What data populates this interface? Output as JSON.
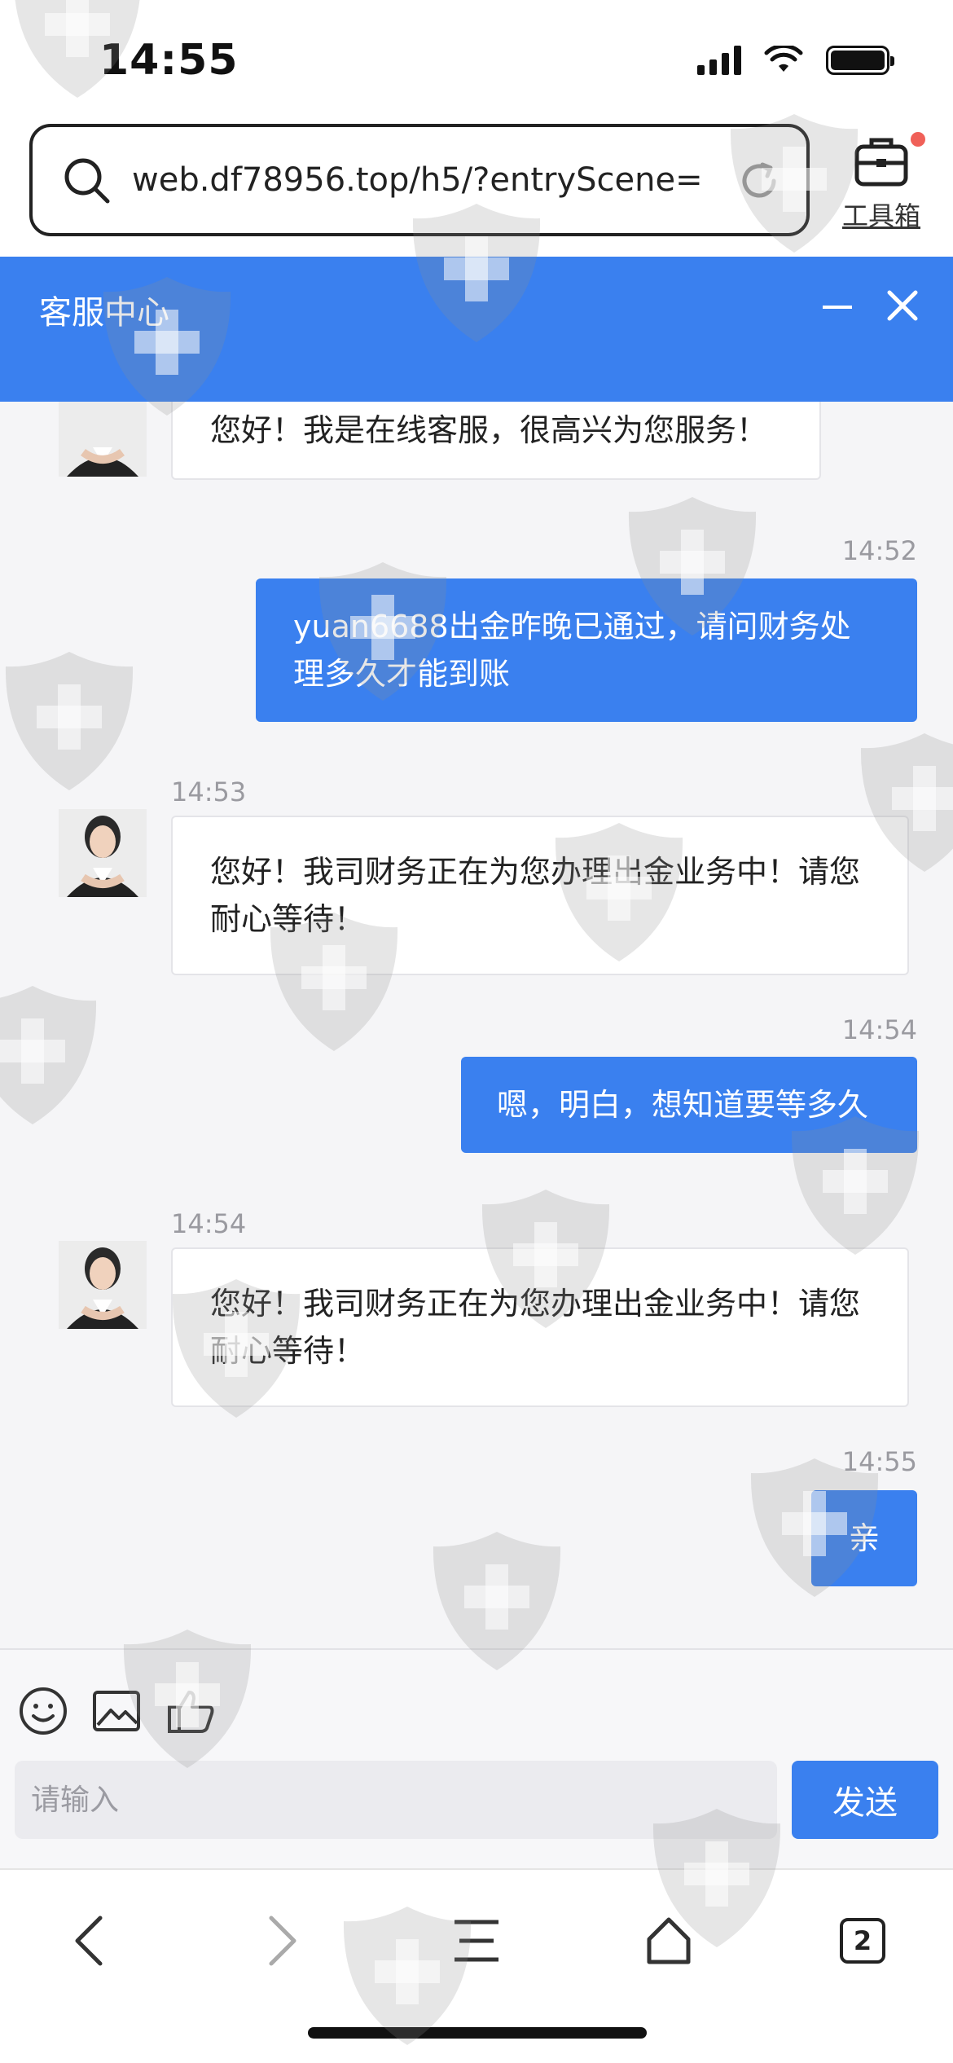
{
  "status_bar": {
    "time": "14:55"
  },
  "browser": {
    "url": "web.df78956.top/h5/?entryScene=...",
    "toolbox_label": "工具箱",
    "tab_count": "2"
  },
  "chat": {
    "title": "客服中心",
    "messages": [
      {
        "side": "in",
        "time": "",
        "text": "您好！我是在线客服，很高兴为您服务！"
      },
      {
        "side": "out",
        "time": "14:52",
        "text": "yuan6688出金昨晚已通过，请问财务处理多久才能到账"
      },
      {
        "side": "in",
        "time": "14:53",
        "text": "您好！我司财务正在为您办理出金业务中！请您耐心等待！"
      },
      {
        "side": "out",
        "time": "14:54",
        "text": "嗯，明白，想知道要等多久"
      },
      {
        "side": "in",
        "time": "14:54",
        "text": "您好！我司财务正在为您办理出金业务中！请您耐心等待！"
      },
      {
        "side": "out",
        "time": "14:55",
        "text": "亲"
      }
    ]
  },
  "composer": {
    "placeholder": "请输入",
    "send_label": "发送"
  },
  "colors": {
    "accent": "#3a80ef",
    "background": "#f5f5f7",
    "notification_dot": "#f06058"
  },
  "icons": {
    "composer": [
      "smile-icon",
      "image-icon",
      "thumbs-up-icon"
    ],
    "nav": [
      "back-icon",
      "forward-icon",
      "menu-icon",
      "home-icon",
      "tabs-icon"
    ]
  }
}
